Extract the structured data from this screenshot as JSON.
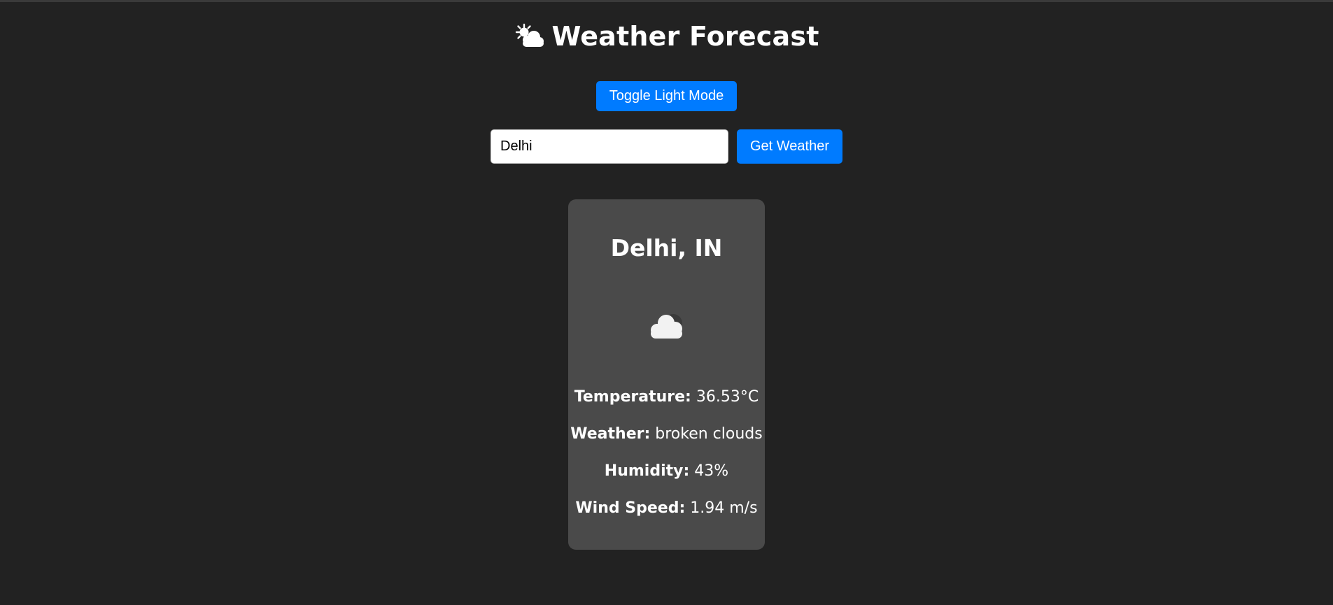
{
  "header": {
    "title": "Weather Forecast",
    "title_icon": "sun-behind-cloud-icon"
  },
  "controls": {
    "toggle_label": "Toggle Light Mode",
    "search_value": "Delhi",
    "get_weather_label": "Get Weather"
  },
  "card": {
    "city": "Delhi, IN",
    "weather_icon": "cloud-icon",
    "details": [
      {
        "label": "Temperature:",
        "value": "36.53°C"
      },
      {
        "label": "Weather:",
        "value": "broken clouds"
      },
      {
        "label": "Humidity:",
        "value": "43%"
      },
      {
        "label": "Wind Speed:",
        "value": "1.94 m/s"
      }
    ]
  },
  "colors": {
    "background": "#222222",
    "card": "#4a4a4a",
    "accent": "#007bff",
    "text": "#ffffff"
  }
}
